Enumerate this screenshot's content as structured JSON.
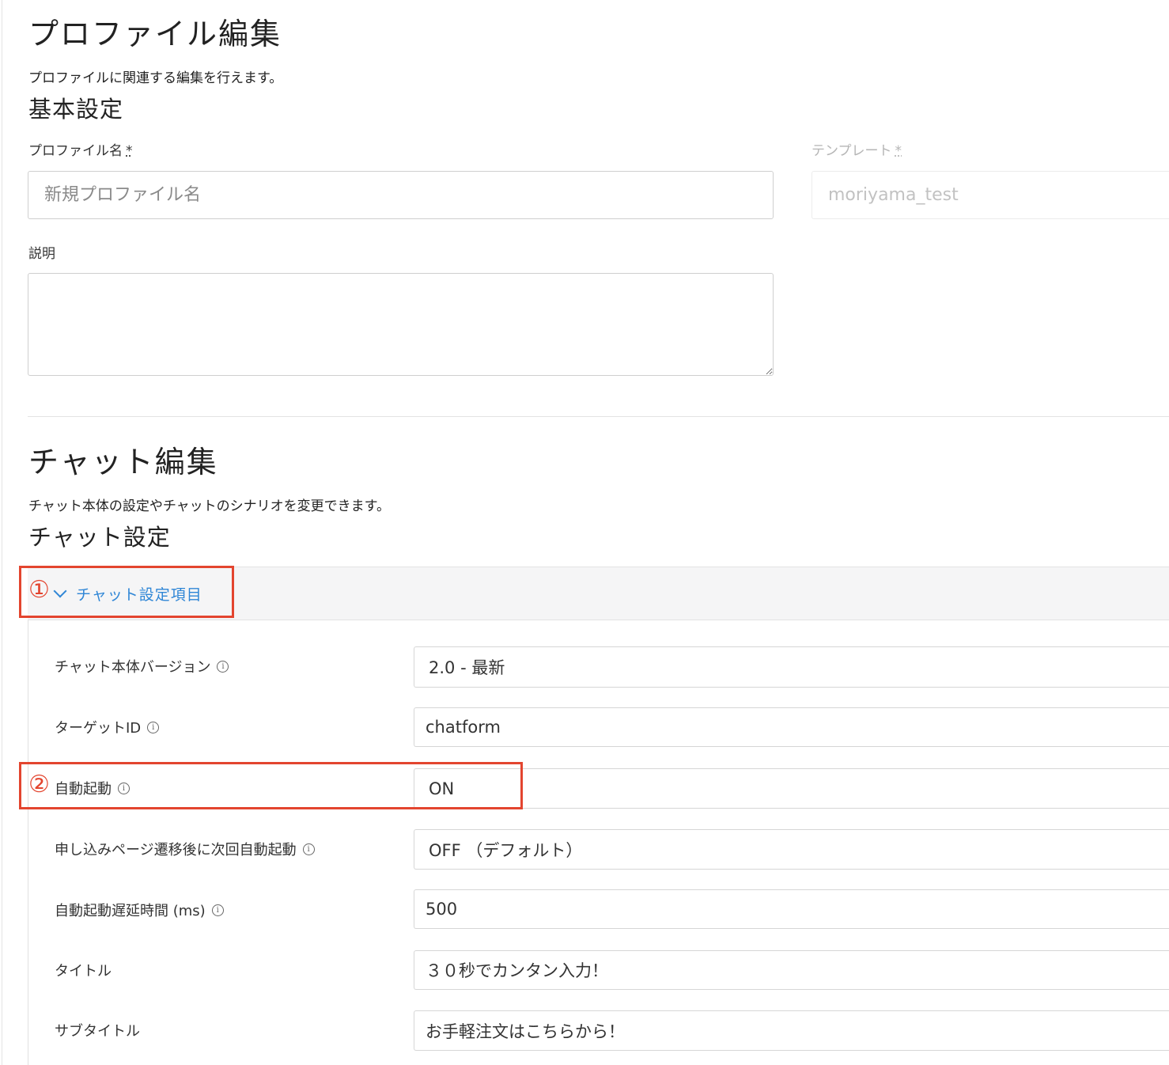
{
  "profile_edit": {
    "title": "プロファイル編集",
    "description": "プロファイルに関連する編集を行えます。"
  },
  "basic_settings": {
    "title": "基本設定",
    "profile_name": {
      "label": "プロファイル名",
      "required_mark": "*",
      "placeholder": "新規プロファイル名"
    },
    "template": {
      "label": "テンプレート",
      "required_mark": "*",
      "value": "moriyama_test"
    },
    "description": {
      "label": "説明",
      "value": ""
    }
  },
  "chat_edit": {
    "title": "チャット編集",
    "description": "チャット本体の設定やチャットのシナリオを変更できます。"
  },
  "chat_settings": {
    "title": "チャット設定",
    "accordion_title": "チャット設定項目",
    "rows": [
      {
        "label": "チャット本体バージョン",
        "value": "2.0 - 最新",
        "info": true
      },
      {
        "label": "ターゲットID",
        "value": "chatform",
        "info": true
      },
      {
        "label": "自動起動",
        "value": "ON",
        "info": true
      },
      {
        "label": "申し込みページ遷移後に次回自動起動",
        "value": "OFF （デフォルト）",
        "info": true
      },
      {
        "label": "自動起動遅延時間 (ms)",
        "value": "500",
        "info": true
      },
      {
        "label": "タイトル",
        "value": "３０秒でカンタン入力！",
        "info": false
      },
      {
        "label": "サブタイトル",
        "value": "お手軽注文はこちらから！",
        "info": false
      }
    ]
  },
  "annotations": {
    "one": "①",
    "two": "②"
  },
  "colors": {
    "accent": "#2f86d6",
    "annotation": "#e3452f"
  }
}
